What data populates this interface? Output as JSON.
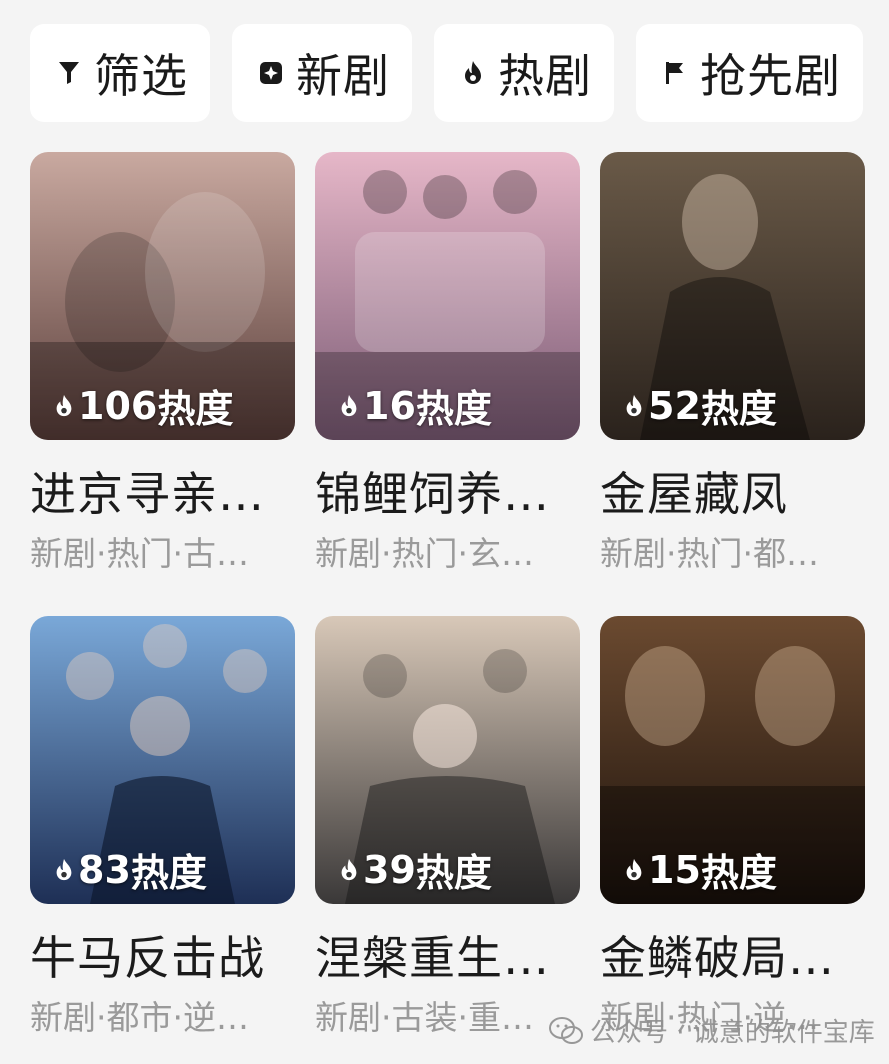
{
  "filters": [
    {
      "label": "筛选",
      "icon": "funnel-icon"
    },
    {
      "label": "新剧",
      "icon": "sparkle-badge-icon"
    },
    {
      "label": "热剧",
      "icon": "flame-icon"
    },
    {
      "label": "抢先剧",
      "icon": "flag-icon"
    }
  ],
  "heat_unit": "热度",
  "dramas": [
    {
      "title": "进京寻亲…",
      "heat": "106",
      "tags": "新剧·热门·古…",
      "colors": [
        "#c9a9a0",
        "#5a3e3a"
      ]
    },
    {
      "title": "锦鲤饲养…",
      "heat": "16",
      "tags": "新剧·热门·玄…",
      "colors": [
        "#e6b7c8",
        "#7a5a74"
      ]
    },
    {
      "title": "金屋藏凤",
      "heat": "52",
      "tags": "新剧·热门·都…",
      "colors": [
        "#6a5a48",
        "#2a221c"
      ]
    },
    {
      "title": "牛马反击战",
      "heat": "83",
      "tags": "新剧·都市·逆…",
      "colors": [
        "#7aa8d8",
        "#1e2f55"
      ]
    },
    {
      "title": "涅槃重生…",
      "heat": "39",
      "tags": "新剧·古装·重…",
      "colors": [
        "#d8c8b8",
        "#3a3838"
      ]
    },
    {
      "title": "金鳞破局…",
      "heat": "15",
      "tags": "新剧·热门·逆…",
      "colors": [
        "#6b4a30",
        "#1c120c"
      ]
    }
  ],
  "watermark": {
    "text": "公众号 · 诚意的软件宝库",
    "icon": "wechat-icon"
  }
}
